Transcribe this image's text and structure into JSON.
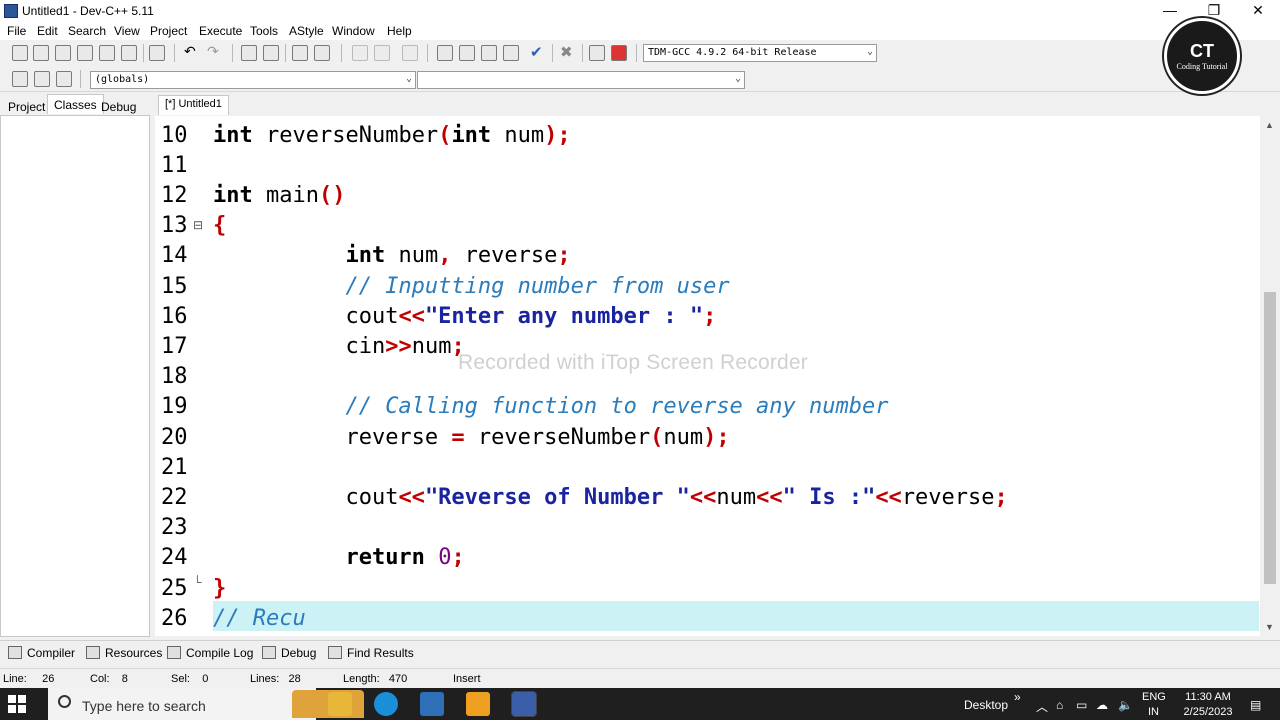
{
  "window": {
    "title": "Untitled1 - Dev-C++ 5.11"
  },
  "menu": [
    "File",
    "Edit",
    "Search",
    "View",
    "Project",
    "Execute",
    "Tools",
    "AStyle",
    "Window",
    "Help"
  ],
  "compiler_select": {
    "value": "TDM-GCC 4.9.2 64-bit Release"
  },
  "scope_select": {
    "value": "(globals)"
  },
  "member_select": {
    "value": ""
  },
  "side_tabs": [
    "Project",
    "Classes",
    "Debug"
  ],
  "editor_tab": "[*] Untitled1",
  "line_numbers": [
    "10",
    "11",
    "12",
    "13",
    "14",
    "15",
    "16",
    "17",
    "18",
    "19",
    "20",
    "21",
    "22",
    "23",
    "24",
    "25",
    "26"
  ],
  "code": {
    "l10": {
      "kw1": "int",
      "name": " reverseNumber",
      "p1": "(",
      "kw2": "int",
      "arg": " num",
      "p2": ");"
    },
    "l12": {
      "kw": "int",
      "name": " main",
      "p": "()"
    },
    "l13": {
      "brace": "{"
    },
    "l14": {
      "indent": "          ",
      "kw": "int",
      "vars": " num",
      "comma": ",",
      "var2": " reverse",
      "semi": ";"
    },
    "l15": {
      "indent": "          ",
      "comment": "// Inputting number from user"
    },
    "l16": {
      "indent": "          ",
      "id": "cout",
      "op": "<<",
      "str": "\"Enter any number : \"",
      "semi": ";"
    },
    "l17": {
      "indent": "          ",
      "id": "cin",
      "op": ">>",
      "var": "num",
      "semi": ";"
    },
    "l19": {
      "indent": "          ",
      "comment": "// Calling function to reverse any number"
    },
    "l20": {
      "indent": "          ",
      "var": "reverse ",
      "op": "=",
      "call": " reverseNumber",
      "p1": "(",
      "arg": "num",
      "p2": ");"
    },
    "l22": {
      "indent": "          ",
      "id": "cout",
      "op1": "<<",
      "str1": "\"Reverse of Number \"",
      "op2": "<<",
      "var1": "num",
      "op3": "<<",
      "str2": "\" Is :\"",
      "op4": "<<",
      "var2": "reverse",
      "semi": ";"
    },
    "l24": {
      "indent": "          ",
      "kw": "return",
      "sp": " ",
      "num": "0",
      "semi": ";"
    },
    "l25": {
      "brace": "}"
    },
    "l26": {
      "comment": "// Recu"
    }
  },
  "watermark": "Recorded with iTop Screen Recorder",
  "badge": {
    "initials": "CT",
    "name": "Coding Tutorial"
  },
  "bottom_tabs": [
    "Compiler",
    "Resources",
    "Compile Log",
    "Debug",
    "Find Results"
  ],
  "status": {
    "line_label": "Line:",
    "line": "26",
    "col_label": "Col:",
    "col": "8",
    "sel_label": "Sel:",
    "sel": "0",
    "lines_label": "Lines:",
    "lines": "28",
    "length_label": "Length:",
    "length": "470",
    "mode": "Insert"
  },
  "taskbar": {
    "search_placeholder": "Type here to search",
    "desktop": "Desktop",
    "lang": "ENG",
    "region": "IN",
    "time": "11:30 AM",
    "date": "2/25/2023"
  }
}
